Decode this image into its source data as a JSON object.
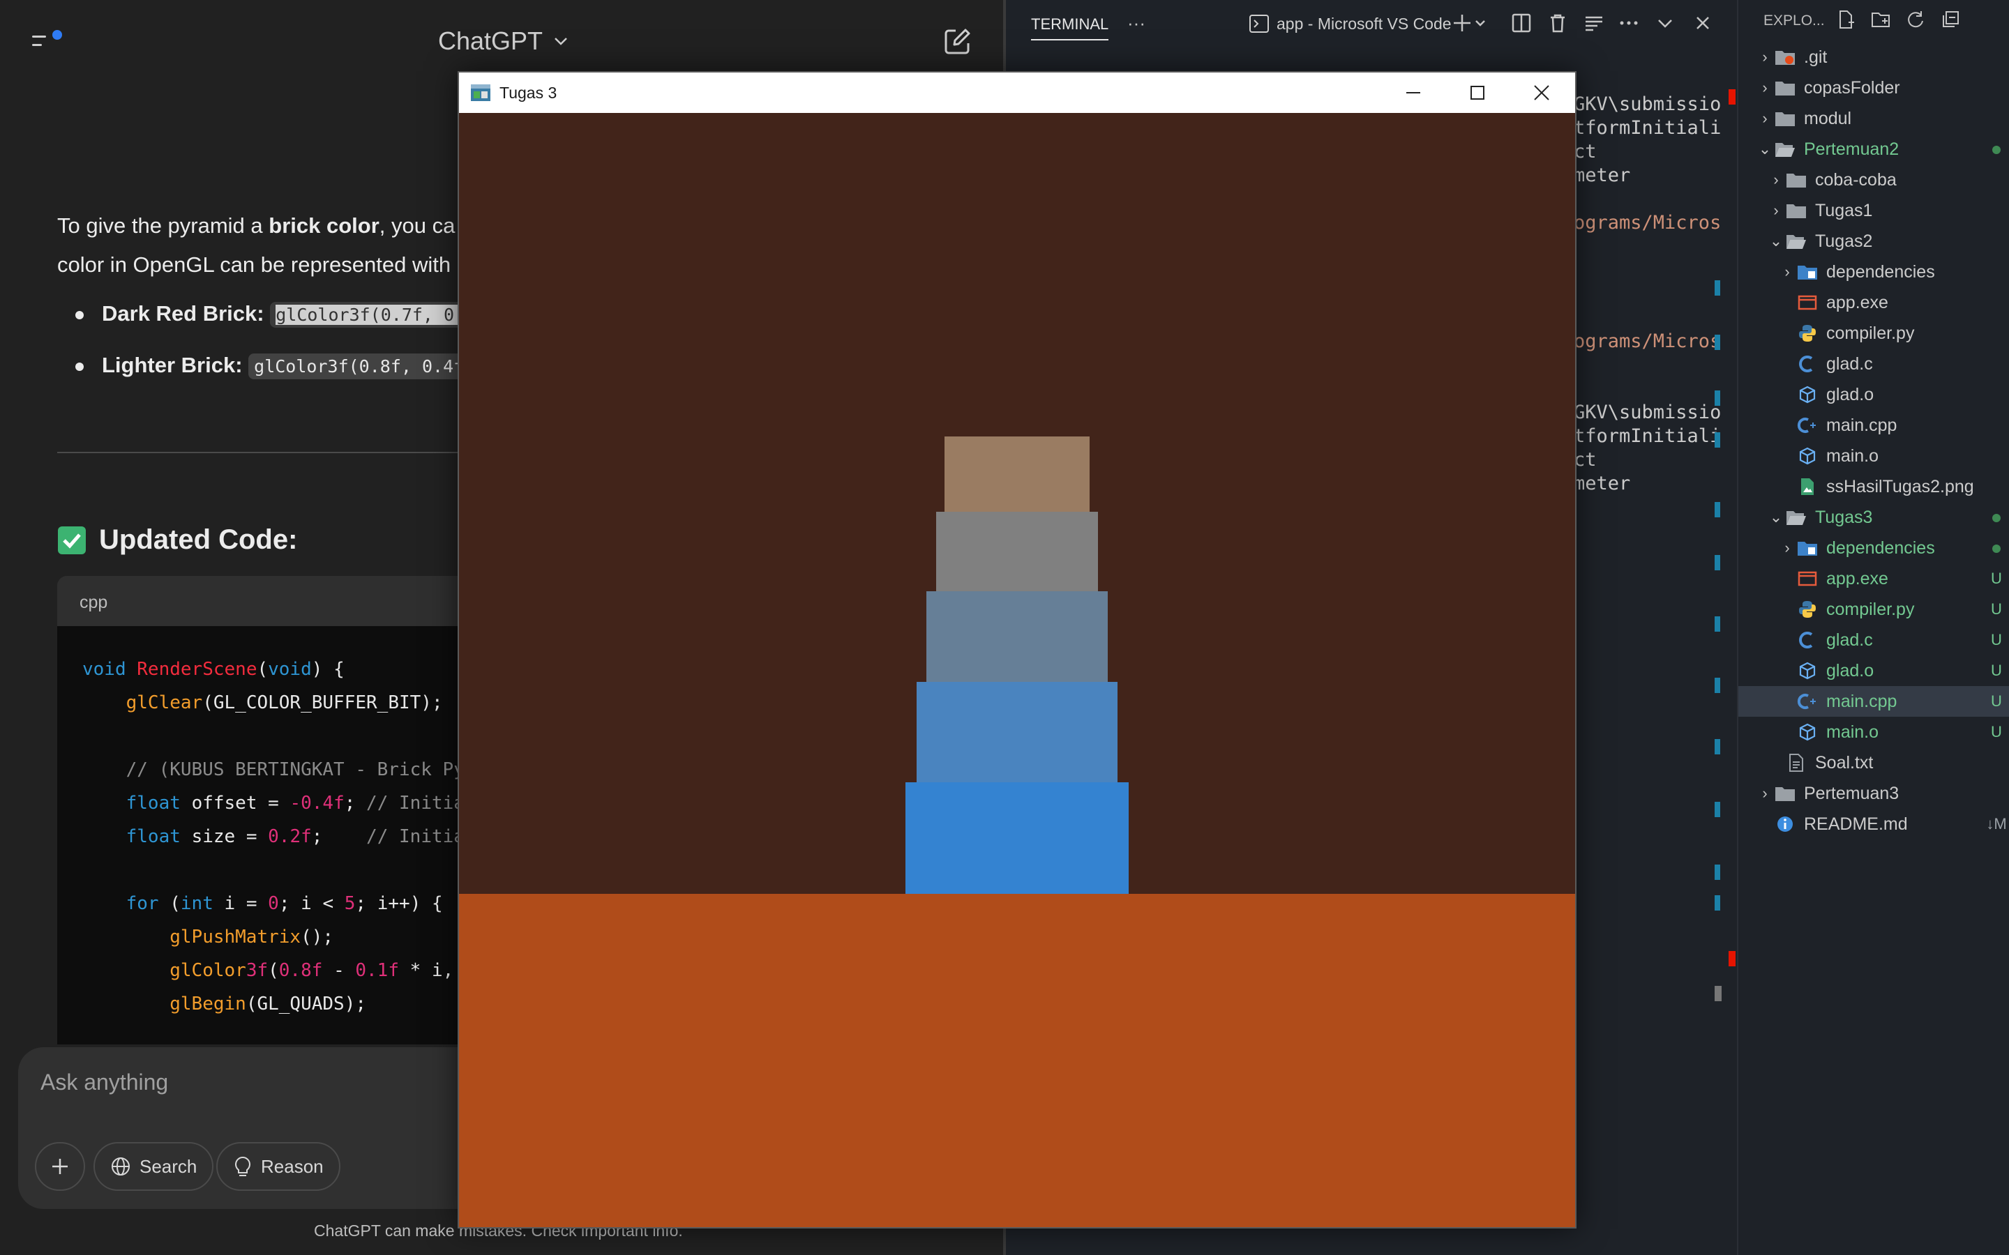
{
  "chat": {
    "model_title": "ChatGPT",
    "para_before_bold": "To give the pyramid a ",
    "para_bold": "brick color",
    "para_after_bold": ", you ca",
    "para_line2": "color in OpenGL can be represented with",
    "bullets": [
      {
        "label": "Dark Red Brick:",
        "code": "glColor3f(0.7f, 0."
      },
      {
        "label": "Lighter Brick:",
        "code": "glColor3f(0.8f, 0.4f"
      }
    ],
    "section_heading": "Updated Code:",
    "code_lang": "cpp",
    "code_lines": [
      "void RenderScene(void) {",
      "    glClear(GL_COLOR_BUFFER_BIT);",
      "",
      "    // (KUBUS BERTINGKAT - Brick Py",
      "    float offset = -0.4f; // Initia",
      "    float size = 0.2f;    // Initia",
      "",
      "    for (int i = 0; i < 5; i++) {",
      "        glPushMatrix();",
      "        glColor3f(0.8f - 0.1f * i, (",
      "        glBegin(GL_QUADS);"
    ],
    "composer_placeholder": "Ask anything",
    "search_label": "Search",
    "reason_label": "Reason",
    "footnote": "ChatGPT can make mistakes. Check important info."
  },
  "terminal": {
    "tab_label": "TERMINAL",
    "more": "···",
    "app_label": "app - Microsoft VS Code",
    "lines": [
      {
        "text": "GKV\\submissio",
        "orange": false
      },
      {
        "text": "tformInitiali",
        "orange": false
      },
      {
        "text": "ct",
        "orange": false
      },
      {
        "text": "meter",
        "orange": false
      },
      {
        "text": "ograms/Micros",
        "orange": true
      },
      {
        "text": "ograms/Micros",
        "orange": true
      },
      {
        "text": "GKV\\submissio",
        "orange": false
      },
      {
        "text": "tformInitiali",
        "orange": false
      },
      {
        "text": "ct",
        "orange": false
      },
      {
        "text": "meter",
        "orange": false
      }
    ]
  },
  "explorer": {
    "title": "EXPLO...",
    "items": [
      {
        "label": ".git",
        "icon": "git-folder-icon",
        "badge": ""
      },
      {
        "label": "copasFolder",
        "icon": "folder-icon",
        "badge": ""
      },
      {
        "label": "modul",
        "icon": "folder-icon",
        "badge": ""
      },
      {
        "label": "Pertemuan2",
        "icon": "folder-open-icon",
        "badge": "●"
      },
      {
        "label": "coba-coba",
        "icon": "folder-icon",
        "badge": ""
      },
      {
        "label": "Tugas1",
        "icon": "folder-icon",
        "badge": ""
      },
      {
        "label": "Tugas2",
        "icon": "folder-open-icon",
        "badge": ""
      },
      {
        "label": "dependencies",
        "icon": "folder-lib-icon",
        "badge": ""
      },
      {
        "label": "app.exe",
        "icon": "exe-icon",
        "badge": ""
      },
      {
        "label": "compiler.py",
        "icon": "python-icon",
        "badge": ""
      },
      {
        "label": "glad.c",
        "icon": "c-file-icon",
        "badge": ""
      },
      {
        "label": "glad.o",
        "icon": "object-file-icon",
        "badge": ""
      },
      {
        "label": "main.cpp",
        "icon": "cpp-file-icon",
        "badge": ""
      },
      {
        "label": "main.o",
        "icon": "object-file-icon",
        "badge": ""
      },
      {
        "label": "ssHasilTugas2.png",
        "icon": "image-file-icon",
        "badge": ""
      },
      {
        "label": "Tugas3",
        "icon": "folder-open-icon",
        "badge": "●"
      },
      {
        "label": "dependencies",
        "icon": "folder-lib-icon",
        "badge": "●"
      },
      {
        "label": "app.exe",
        "icon": "exe-icon",
        "badge": "U"
      },
      {
        "label": "compiler.py",
        "icon": "python-icon",
        "badge": "U"
      },
      {
        "label": "glad.c",
        "icon": "c-file-icon",
        "badge": "U"
      },
      {
        "label": "glad.o",
        "icon": "object-file-icon",
        "badge": "U"
      },
      {
        "label": "main.cpp",
        "icon": "cpp-file-icon",
        "badge": "U"
      },
      {
        "label": "main.o",
        "icon": "object-file-icon",
        "badge": "U"
      },
      {
        "label": "Soal.txt",
        "icon": "text-file-icon",
        "badge": ""
      },
      {
        "label": "Pertemuan3",
        "icon": "folder-icon",
        "badge": ""
      },
      {
        "label": "README.md",
        "icon": "info-icon",
        "badge": "↓M"
      }
    ]
  },
  "window": {
    "title": "Tugas 3",
    "colors": {
      "background": "#42241a",
      "floor": "#b04c1a",
      "tiers_top_to_bottom": [
        "#9a7c62",
        "#808080",
        "#667f97",
        "#4a84bf",
        "#3483d1"
      ]
    }
  }
}
